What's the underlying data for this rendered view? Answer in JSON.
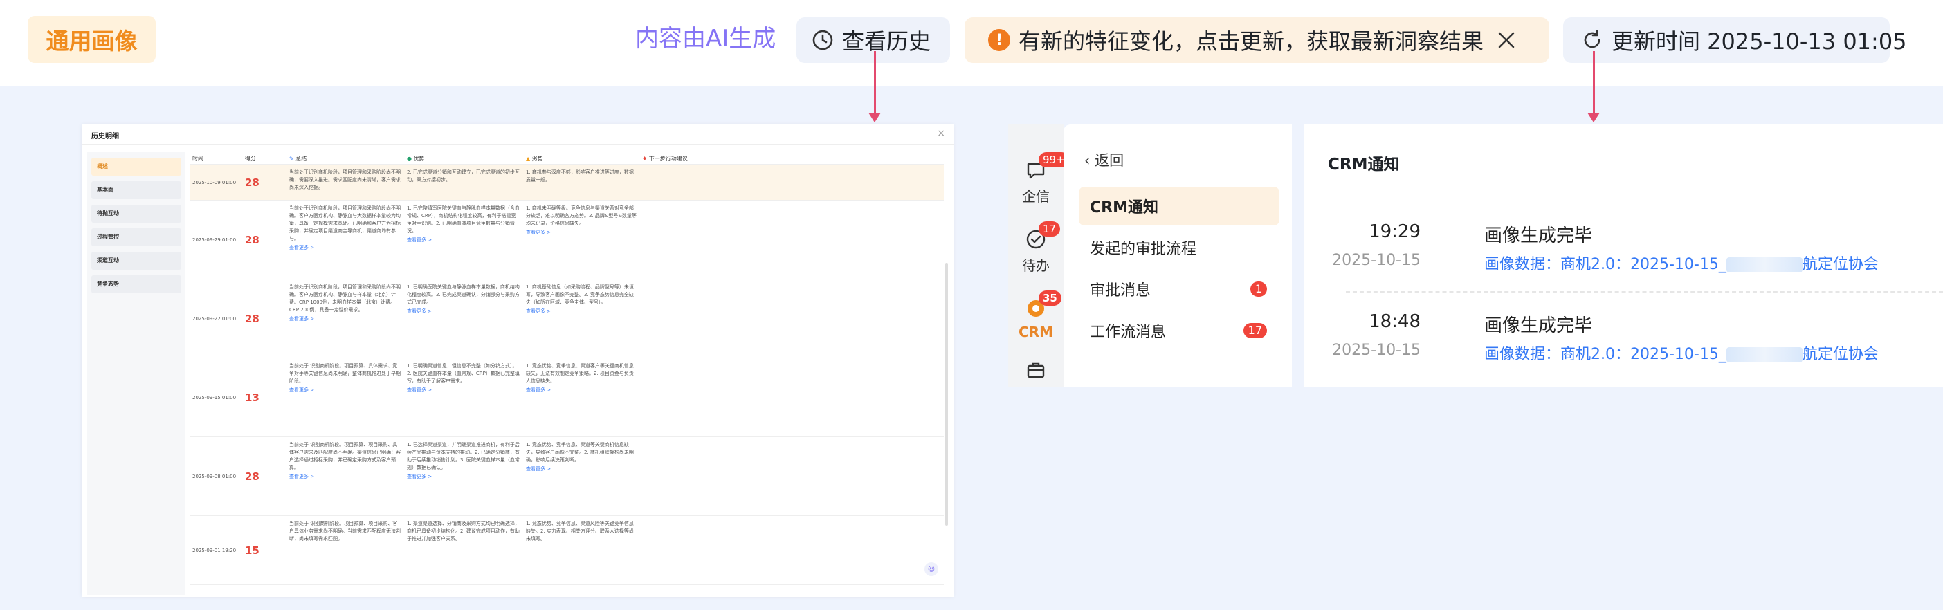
{
  "topbar": {
    "tag": "通用画像",
    "ai_note": "内容由AI生成",
    "history_label": "查看历史",
    "notice": "有新的特征变化，点击更新，获取最新洞察结果",
    "update_time": "更新时间 2025-10-13 01:05",
    "accent": "#f08c1e",
    "ai_color": "#8574f5"
  },
  "history": {
    "title": "历史明细",
    "sidebar": [
      "概述",
      "基本面",
      "待抛互动",
      "过程管控",
      "渠道互动",
      "竞争态势"
    ],
    "columns": [
      "时间",
      "得分",
      "总结",
      "优势",
      "劣势",
      "下一步行动建议"
    ],
    "see_more": "查看更多 >",
    "rows": [
      {
        "time": "2025-10-09 01:00",
        "score": "28",
        "summary": "当前处于识别商机阶段，项目管理和采购阶段尚不明确，需要深入推进。需求匹配度尚未清晰，客户需求尚未深入挖掘。",
        "adv": "2. 已完成渠道分销和互动建立，已完成渠道的初步互动，双方对接初步。",
        "dis": "1. 商机参与深度不够，影响客户推进等进度，数据质量一般。"
      },
      {
        "time": "2025-09-29 01:00",
        "score": "28",
        "summary": "当前处于识别商机阶段，项目管理和采购阶段尚不明确。客户方医疗机构、静脉血与大数据样本量较为均衡，具备一定规模需求基础。已明确和客户方为招标采购，并确定项目渠道商主导商机，渠道商均有参与。",
        "adv": "1. 已完整填写医院关键血与静脉血样本量数据（含血常规、CRP），商机结构化程度较高，有利于搭建竞争对手识别。2. 已明确血液项目竞争数量与分销情况。",
        "dis": "1. 商机未明确等级。竞争信息与渠道关系对竞争部分缺乏，难以明确各方态势。2. 品牌&型号&数量等均未记录，价格信息缺失。"
      },
      {
        "time": "2025-09-22 01:00",
        "score": "28",
        "summary": "当前处于识别商机阶段，项目管理和采购阶段尚不明确。客户方医疗机构、静脉血与样本量（北京）计费。CRP 1000例，未明血样本量（北京）计费。CRP 200例，具备一定性价需求。",
        "adv": "1. 已明确医院关键血与静脉血样本量数据，商机结构化程度较高。2. 已完成渠道确认，分销部分与采购方式已完成。",
        "dis": "1. 商机基础信息（如采购流程、品牌型号等）未填写，导致客户画像不完整。2. 竞争态势信息完全缺失（如所在区域、竞争主体、型号）。"
      },
      {
        "time": "2025-09-15 01:00",
        "score": "13",
        "summary": "当前处于 识别商机阶段。项目预算、具体需求、竞争对手等关键信息尚未明确，整体商机推进处于早期阶段。",
        "adv": "1. 已明确渠道信息，但信息不完整（如分销方式）。2. 医院关键血样本量（血常规、CRP）数据已完整填写，有助于了解客户需求。",
        "dis": "1. 竞态优势、竞争信息、渠道客户等关键商机信息缺失，无法有效制定竞争策略。2. 项目资金与负责人信息缺失。"
      },
      {
        "time": "2025-09-08 01:00",
        "score": "28",
        "summary": "当前处于 识别商机阶段。项目预算、项目采购、具体客户需求及匹配度尚不明确。渠道信息已明确：客户选择通过招标采购，并已确定采购方式及客户预算。",
        "adv": "1. 已选择渠道渠道，并明确渠道推进商机，有利于后续产品推动与资本支持的推动。2. 已确定分销商，有助于后续推动销售计划。3. 医院关键血样本量（血常规）数据已确认。",
        "dis": "1. 竞态优势、竞争信息、渠道等关键商机信息缺失，导致客户画像不完整。2. 商机组织架构尚未明确，影响后续决策判断。"
      },
      {
        "time": "2025-09-01 19:20",
        "score": "15",
        "summary": "当前处于 识别商机阶段。项目预算、项目采购、客户具体业务需求尚不明确。当前需求匹配程度无法判断，尚未填写需求匹配。",
        "adv": "1. 渠道渠道选择、分销商及采购方式均已明确选择，商机已具备初步结构化。2. 建议完成项目动作，有助于推进并加强客户关系。",
        "dis": "1. 竞态优势、竞争信息、渠道风险等关键竞争信息缺失。2. 实力表现、相关方评分、联系人选择等尚未填写。"
      }
    ]
  },
  "crm": {
    "rail": [
      {
        "label": "企信",
        "badge": "99+",
        "icon": "chat-icon"
      },
      {
        "label": "待办",
        "badge": "17",
        "icon": "check-circle-icon"
      },
      {
        "label": "CRM",
        "badge": "35",
        "icon": "crm-icon"
      },
      {
        "label": "",
        "badge": "",
        "icon": "briefcase-icon"
      }
    ],
    "back": "返回",
    "menu": [
      {
        "label": "CRM通知",
        "badge": ""
      },
      {
        "label": "发起的审批流程",
        "badge": ""
      },
      {
        "label": "审批消息",
        "badge": "1"
      },
      {
        "label": "工作流消息",
        "badge": "17"
      }
    ],
    "main_title": "CRM通知",
    "notifications": [
      {
        "time": "19:29",
        "date": "2025-10-15",
        "title": "画像生成完毕",
        "link_prefix": "画像数据：商机2.0：2025-10-15_",
        "link_suffix": "航定位协会"
      },
      {
        "time": "18:48",
        "date": "2025-10-15",
        "title": "画像生成完毕",
        "link_prefix": "画像数据：商机2.0：2025-10-15_",
        "link_suffix": "航定位协会"
      }
    ]
  }
}
